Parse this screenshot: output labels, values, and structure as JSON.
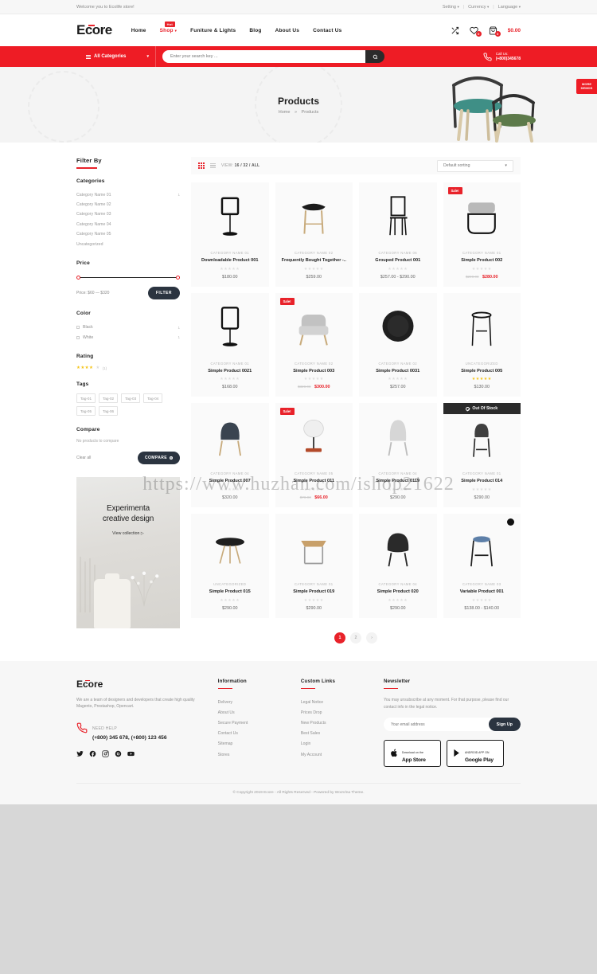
{
  "topbar": {
    "welcome": "Welcome you to Ecolife store!",
    "links": [
      "Setting",
      "Currency",
      "Language"
    ]
  },
  "header": {
    "logo": "Ecore",
    "nav": [
      {
        "label": "Home",
        "active": false,
        "badge": ""
      },
      {
        "label": "Shop",
        "active": true,
        "badge": "Hot"
      },
      {
        "label": "Funiture & Lights",
        "active": false,
        "badge": ""
      },
      {
        "label": "Blog",
        "active": false,
        "badge": ""
      },
      {
        "label": "About Us",
        "active": false,
        "badge": ""
      },
      {
        "label": "Contact Us",
        "active": false,
        "badge": ""
      }
    ],
    "compare_icon": "compare-icon",
    "wishlist_count": "0",
    "cart_count": "0",
    "cart_total": "$0.00"
  },
  "searchbar": {
    "all_categories": "All Categories",
    "placeholder": "Enter your search key ...",
    "search_icon": "search-icon",
    "call_label": "Call Us:",
    "call_number": "(+800)345678"
  },
  "hero": {
    "title": "Products",
    "crumb_home": "Home",
    "crumb_sep": "»",
    "crumb_current": "Products",
    "more_demos": "MORE DEMOS"
  },
  "sidebar": {
    "filter_by": "Filter By",
    "categories_head": "Categories",
    "categories": [
      {
        "label": "Category Name 01",
        "count": "1"
      },
      {
        "label": "Category Name 02",
        "count": ""
      },
      {
        "label": "Category Name 03",
        "count": ""
      },
      {
        "label": "Category Name 04",
        "count": ""
      },
      {
        "label": "Category Name 05",
        "count": ""
      },
      {
        "label": "Uncategorized",
        "count": ""
      }
    ],
    "price_head": "Price",
    "price_label": "Price: $60 — $320",
    "filter_button": "FILTER",
    "color_head": "Color",
    "colors": [
      {
        "label": "Black",
        "count": "1"
      },
      {
        "label": "White",
        "count": "1"
      }
    ],
    "rating_head": "Rating",
    "rating_stars": "★★★★",
    "rating_empty": "★",
    "rating_count": "(1)",
    "tags_head": "Tags",
    "tags": [
      "Tag-01",
      "Tag-02",
      "Tag-03",
      "Tag-04",
      "Tag-05",
      "Tag-06"
    ],
    "compare_head": "Compare",
    "compare_note": "No products to compare",
    "clear_all": "Clear all",
    "compare_button": "COMPARE",
    "compare_badge": "0"
  },
  "promo": {
    "line1": "Experimenta",
    "line2": "creative design",
    "link": "View collection"
  },
  "toolbar": {
    "grid_icon": "grid-view-icon",
    "list_icon": "list-view-icon",
    "view_label": "VIEW:",
    "view_options": "16 / 32 / ALL",
    "sort_value": "Default sorting"
  },
  "products": [
    {
      "category": "CATEGORY NAME 01",
      "name": "Downloadable Product 001",
      "price": "$180.00",
      "old_price": "",
      "sale": false,
      "rated": false,
      "out_of_stock": false
    },
    {
      "category": "CATEGORY NAME 02",
      "name": "Frequently Bought Together -..",
      "price": "$259.00",
      "old_price": "",
      "sale": false,
      "rated": false,
      "out_of_stock": false
    },
    {
      "category": "CATEGORY NAME 06",
      "name": "Grouped Product 001",
      "price": "$257.00 - $290.00",
      "old_price": "",
      "sale": false,
      "rated": false,
      "out_of_stock": false
    },
    {
      "category": "CATEGORY NAME 01",
      "name": "Simple Product 002",
      "price": "$280.00",
      "old_price": "$290.00",
      "sale": true,
      "rated": false,
      "out_of_stock": false
    },
    {
      "category": "CATEGORY NAME 01",
      "name": "Simple Product 0021",
      "price": "$168.00",
      "old_price": "",
      "sale": false,
      "rated": false,
      "out_of_stock": false
    },
    {
      "category": "CATEGORY NAME 02",
      "name": "Simple Product 003",
      "price": "$300.00",
      "old_price": "$320.00",
      "sale": true,
      "rated": false,
      "out_of_stock": false
    },
    {
      "category": "CATEGORY NAME 02",
      "name": "Simple Product 0031",
      "price": "$257.00",
      "old_price": "",
      "sale": false,
      "rated": false,
      "out_of_stock": false
    },
    {
      "category": "UNCATEGORIZED",
      "name": "Simple Product 005",
      "price": "$130.00",
      "old_price": "",
      "sale": false,
      "rated": true,
      "out_of_stock": false
    },
    {
      "category": "CATEGORY NAME 04",
      "name": "Simple Product 007",
      "price": "$320.00",
      "old_price": "",
      "sale": false,
      "rated": false,
      "out_of_stock": false
    },
    {
      "category": "CATEGORY NAME 05",
      "name": "Simple Product 011",
      "price": "$66.00",
      "old_price": "$70.00",
      "sale": true,
      "rated": false,
      "out_of_stock": false
    },
    {
      "category": "CATEGORY NAME 04",
      "name": "Simple Product 0119",
      "price": "$290.00",
      "old_price": "",
      "sale": false,
      "rated": false,
      "out_of_stock": false
    },
    {
      "category": "CATEGORY NAME 01",
      "name": "Simple Product 014",
      "price": "$290.00",
      "old_price": "",
      "sale": false,
      "rated": false,
      "out_of_stock": true,
      "out_of_stock_label": "Out Of Stock"
    },
    {
      "category": "UNCATEGORIZED",
      "name": "Simple Product 015",
      "price": "$290.00",
      "old_price": "",
      "sale": false,
      "rated": false,
      "out_of_stock": false
    },
    {
      "category": "CATEGORY NAME 01",
      "name": "Simple Product 019",
      "price": "$290.00",
      "old_price": "",
      "sale": false,
      "rated": false,
      "out_of_stock": false
    },
    {
      "category": "CATEGORY NAME 04",
      "name": "Simple Product 020",
      "price": "$290.00",
      "old_price": "",
      "sale": false,
      "rated": false,
      "out_of_stock": false
    },
    {
      "category": "CATEGORY NAME 03",
      "name": "Variable Product 001",
      "price": "$138.00 - $140.00",
      "old_price": "",
      "sale": false,
      "rated": false,
      "out_of_stock": false
    }
  ],
  "pagination": {
    "pages": [
      "1",
      "2"
    ],
    "next": "›"
  },
  "footer": {
    "logo": "Ecore",
    "description": "We are a team of designers and developers that create high quality Magento, Prestashop, Opencart.",
    "need_help_label": "NEED HELP",
    "phone": "(+800) 345 678, (+800) 123 456",
    "socials": [
      "twitter-icon",
      "facebook-icon",
      "instagram-icon",
      "google-icon",
      "youtube-icon"
    ],
    "col_information": {
      "head": "Information",
      "items": [
        "Delivery",
        "About Us",
        "Secure Payment",
        "Contact Us",
        "Sitemap",
        "Stores"
      ]
    },
    "col_custom": {
      "head": "Custom Links",
      "items": [
        "Legal Notice",
        "Prices Drop",
        "New Products",
        "Best Sales",
        "Login",
        "My Account"
      ]
    },
    "newsletter": {
      "head": "Newsletter",
      "description": "You may unsubscribe at any moment. For that purpose, please find our contact info in the legal notice.",
      "placeholder": "Your email address",
      "button": "Sign Up",
      "appstore_small": "Download on the",
      "appstore_big": "App Store",
      "play_small": "ANDROID APP ON",
      "play_big": "Google Play"
    },
    "copyright": "© Copyright 2019 Ecore - All Rights Reserved - Powered by WooVina Theme."
  },
  "watermark": "https://www.huzhan.com/ishop21622"
}
